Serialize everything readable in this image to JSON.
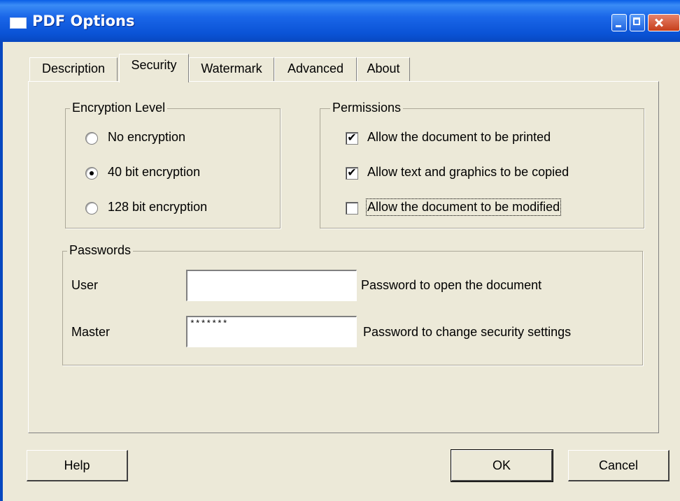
{
  "window": {
    "title": "PDF Options"
  },
  "tabs": [
    "Description",
    "Security",
    "Watermark",
    "Advanced",
    "About"
  ],
  "active_tab": "Security",
  "encryption": {
    "legend": "Encryption Level",
    "options": [
      {
        "label": "No encryption",
        "checked": false
      },
      {
        "label": "40 bit encryption",
        "checked": true
      },
      {
        "label": "128 bit encryption",
        "checked": false
      }
    ]
  },
  "permissions": {
    "legend": "Permissions",
    "items": [
      {
        "label": "Allow the document to be printed",
        "checked": true
      },
      {
        "label": "Allow text and graphics to be copied",
        "checked": true
      },
      {
        "label": "Allow the document to be modified",
        "checked": false
      }
    ]
  },
  "passwords": {
    "legend": "Passwords",
    "user": {
      "label": "User",
      "value": "",
      "hint": "Password to open the document"
    },
    "master": {
      "label": "Master",
      "value": "*******",
      "hint": "Password to change security settings"
    }
  },
  "buttons": {
    "help": "Help",
    "ok": "OK",
    "cancel": "Cancel"
  },
  "check_mark": "✔"
}
